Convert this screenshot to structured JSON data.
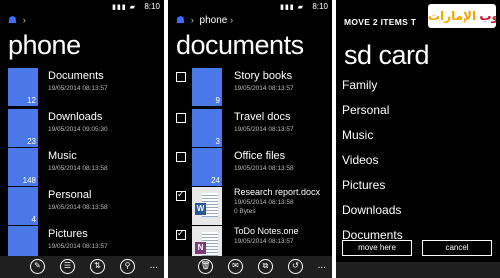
{
  "status": {
    "time": "8:10",
    "icons": "▮▮▮ ▰"
  },
  "screen1": {
    "breadcrumb_chevron": "›",
    "title": "phone",
    "items": [
      {
        "name": "Documents",
        "date": "19/05/2014 08:13:57",
        "count": "12"
      },
      {
        "name": "Downloads",
        "date": "19/05/2014 09:05:30",
        "count": "23"
      },
      {
        "name": "Music",
        "date": "19/05/2014 08:13:58",
        "count": "148"
      },
      {
        "name": "Personal",
        "date": "19/05/2014 08:13:58",
        "count": "4"
      },
      {
        "name": "Pictures",
        "date": "19/05/2014 08:13:57",
        "count": ""
      }
    ],
    "appbar_more": "..."
  },
  "screen2": {
    "breadcrumb_chevron": "›",
    "breadcrumb_path": "phone",
    "title": "documents",
    "items": [
      {
        "name": "Story books",
        "date": "19/05/2014 08:13:57",
        "count": "9",
        "checked": false,
        "kind": "folder"
      },
      {
        "name": "Travel docs",
        "date": "19/05/2014 08:13:57",
        "count": "3",
        "checked": false,
        "kind": "folder"
      },
      {
        "name": "Office files",
        "date": "19/05/2014 08:13:58",
        "count": "24",
        "checked": false,
        "kind": "folder"
      },
      {
        "name": "Research report.docx",
        "date": "19/05/2014 08:13:58",
        "size": "0 Bytes",
        "checked": true,
        "kind": "word",
        "badge": "W"
      },
      {
        "name": "ToDo Notes.one",
        "date": "19/05/2014 08:13:57",
        "size": "",
        "checked": true,
        "kind": "onenote",
        "badge": "N"
      }
    ],
    "appbar_more": "..."
  },
  "screen3": {
    "header": "MOVE 2 ITEMS T",
    "title": "sd card",
    "items": [
      "Family",
      "Personal",
      "Music",
      "Videos",
      "Pictures",
      "Downloads",
      "Documents"
    ],
    "move_label": "move here",
    "cancel_label": "cancel",
    "logo_text_a": "قروب",
    "logo_text_b": "الإمارات"
  },
  "colors": {
    "folder": "#4a78e8",
    "home": "#3d6bff",
    "word": "#2b5797",
    "onenote": "#80397b"
  }
}
